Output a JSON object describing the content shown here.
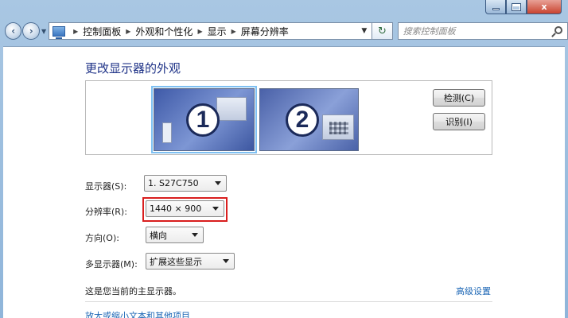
{
  "window": {
    "buttons": {
      "minimize": "minimize",
      "maximize": "maximize",
      "close": "x"
    }
  },
  "nav": {
    "breadcrumbs": [
      "控制面板",
      "外观和个性化",
      "显示",
      "屏幕分辨率"
    ],
    "search_placeholder": "搜索控制面板"
  },
  "page": {
    "heading": "更改显示器的外观",
    "monitors": [
      {
        "number": "1",
        "selected": true
      },
      {
        "number": "2",
        "selected": false
      }
    ],
    "detect_button": "检测(C)",
    "identify_button": "识别(I)",
    "display_label": "显示器(S):",
    "display_value": "1. S27C750",
    "resolution_label": "分辨率(R):",
    "resolution_value": "1440 × 900",
    "orientation_label": "方向(O):",
    "orientation_value": "横向",
    "multi_label": "多显示器(M):",
    "multi_value": "扩展这些显示",
    "primary_note": "这是您当前的主显示器。",
    "advanced_link": "高级设置",
    "text_size_link": "放大或缩小文本和其他项目"
  },
  "colors": {
    "heading": "#1e3287",
    "link": "#1b66b5",
    "highlight": "#d91e1e",
    "selected_outline": "#7ec0f2"
  }
}
